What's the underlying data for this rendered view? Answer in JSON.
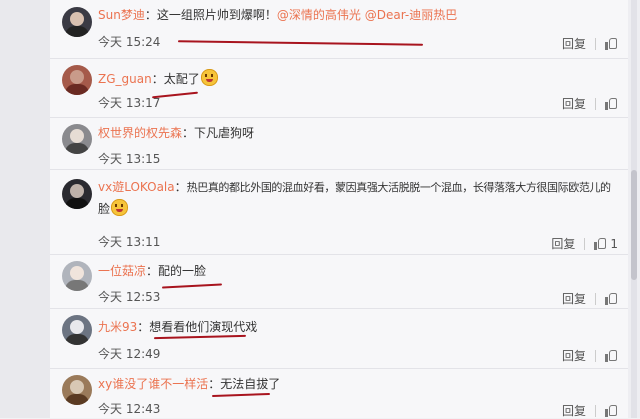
{
  "comments": [
    {
      "user": "Sun梦迪",
      "sep": "：",
      "text": "这一组照片帅到爆啊！",
      "mentions": [
        "@深情的高伟光",
        "@Dear-迪丽热巴"
      ],
      "time": "今天 15:24",
      "reply": "回复",
      "likes": "",
      "avatar_color": "#3a3a44"
    },
    {
      "user": "ZG_guan",
      "sep": "：",
      "text": "太配了",
      "emoji": "face-tears-icon",
      "time": "今天 13:17",
      "reply": "回复",
      "likes": "",
      "avatar_color": "#a55a4a"
    },
    {
      "user": "权世界的权先森",
      "sep": "：",
      "text": "下凡虐狗呀",
      "time": "今天 13:15",
      "reply": "回复",
      "likes": "",
      "avatar_color": "#8a8a8e"
    },
    {
      "user": "vx遊LOKOala",
      "sep": "：",
      "text": "热巴真的都比外国的混血好看，蒙因真强大活脱脱一个混血，长得落落大方很国际欧范儿的",
      "text2": "脸",
      "emoji": "face-heart-eyes-icon",
      "time": "今天 13:11",
      "reply": "回复",
      "likes": "1",
      "avatar_color": "#2a2a30"
    },
    {
      "user": "一位菇凉",
      "sep": "：",
      "text": "配的一脸",
      "time": "今天 12:53",
      "reply": "回复",
      "likes": "",
      "avatar_color": "#b0b4bc"
    },
    {
      "user": "九米93",
      "sep": "：",
      "text": "想看看他们演现代戏",
      "time": "今天 12:49",
      "reply": "回复",
      "likes": "",
      "avatar_color": "#6c7482"
    },
    {
      "user": "xy谁没了谁不一样活",
      "sep": "：",
      "text": "无法自拔了",
      "time": "今天 12:43",
      "reply": "回复",
      "likes": "",
      "avatar_color": "#9a7a5a"
    }
  ],
  "colors": {
    "username": "#eb7350",
    "ink": "#a8141e",
    "background": "#f7f7f9"
  }
}
